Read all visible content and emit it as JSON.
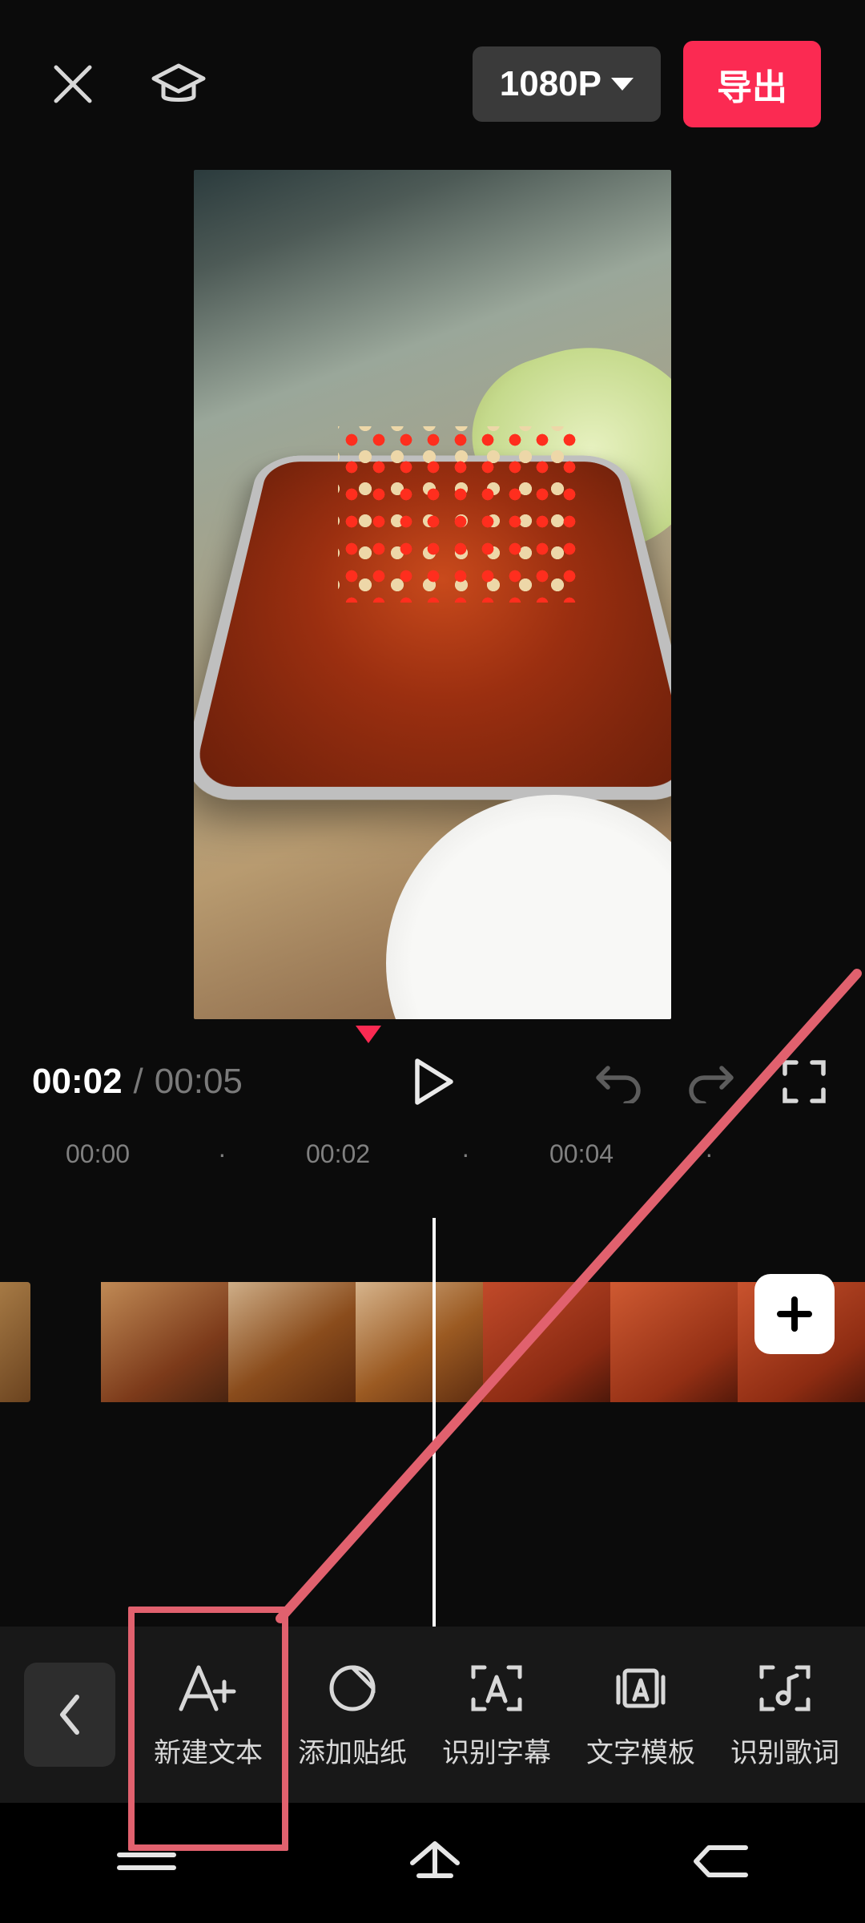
{
  "header": {
    "resolution_label": "1080P",
    "export_label": "导出"
  },
  "playback": {
    "current_time": "00:02",
    "separator": "/",
    "duration": "00:05"
  },
  "ruler": {
    "ticks": [
      "00:00",
      "·",
      "00:02",
      "·",
      "00:04",
      "·"
    ]
  },
  "add_clip": {
    "icon": "plus-icon"
  },
  "toolbar": {
    "items": [
      {
        "icon": "text-add-icon",
        "label": "新建文本"
      },
      {
        "icon": "sticker-icon",
        "label": "添加贴纸"
      },
      {
        "icon": "caption-icon",
        "label": "识别字幕"
      },
      {
        "icon": "template-icon",
        "label": "文字模板"
      },
      {
        "icon": "lyrics-icon",
        "label": "识别歌词"
      }
    ]
  },
  "annotation": {
    "highlight_tool_index": 0
  }
}
